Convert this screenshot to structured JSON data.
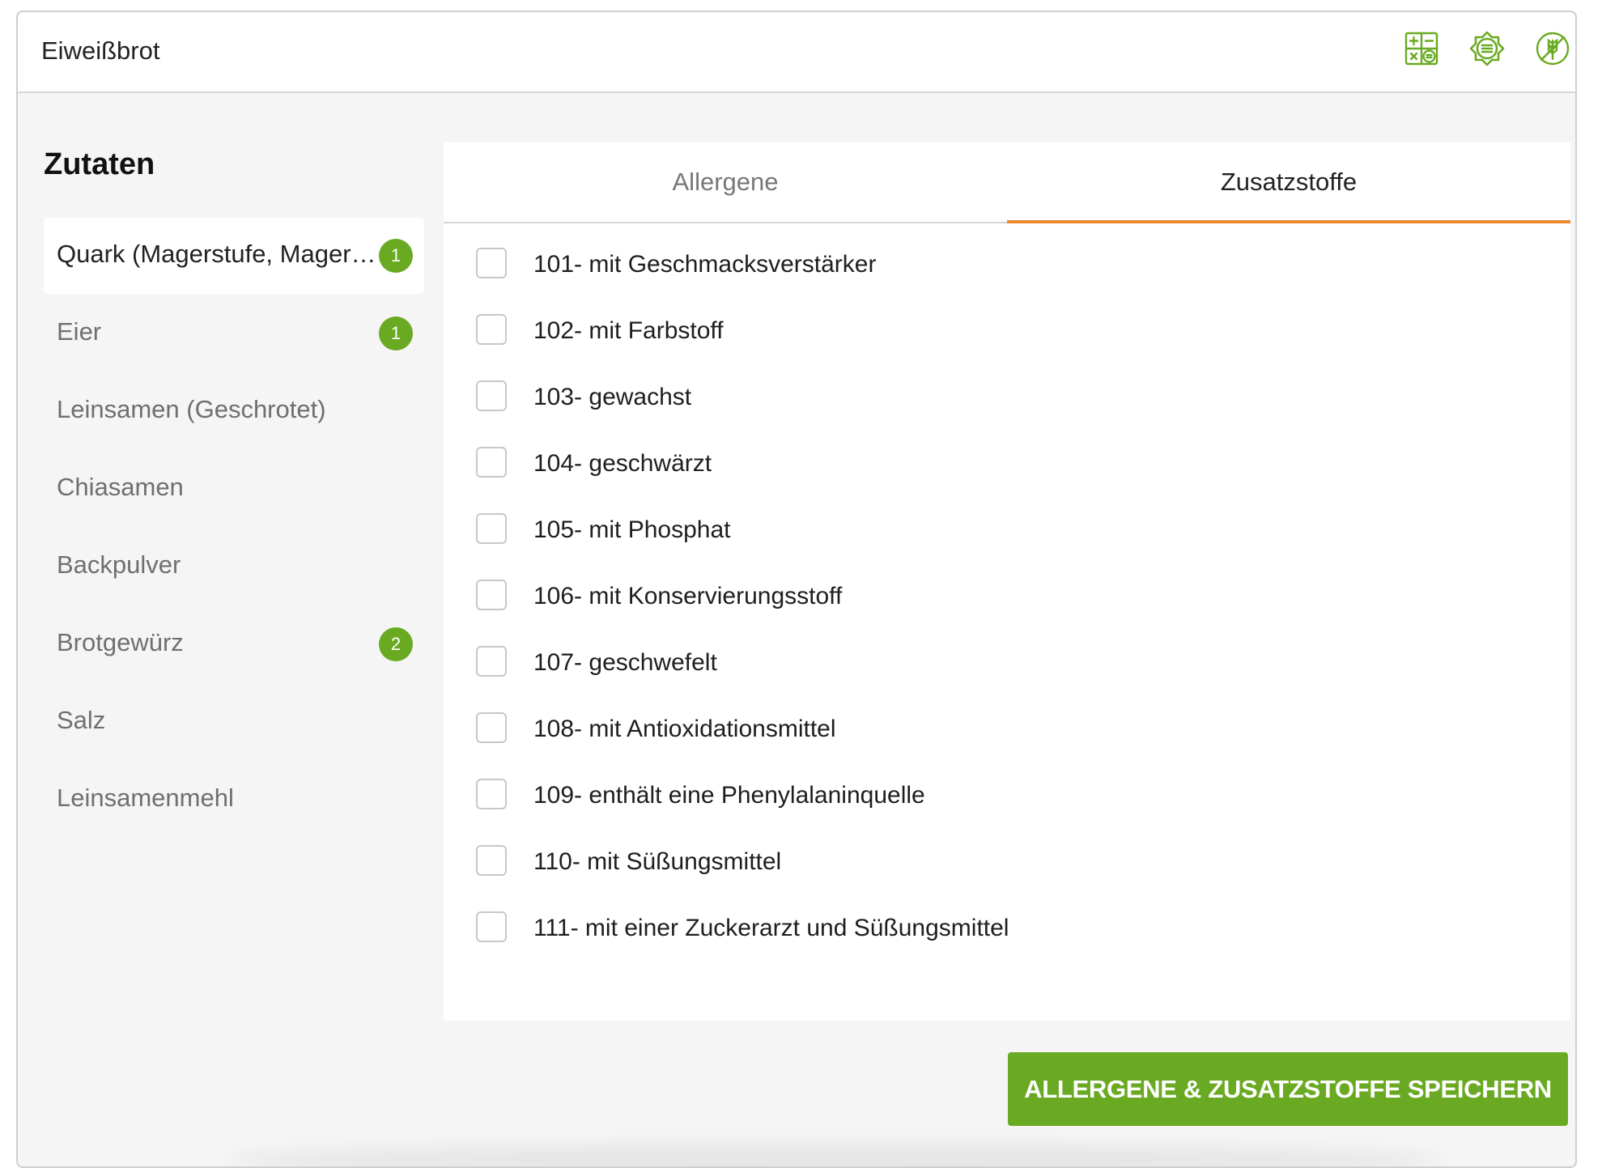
{
  "header": {
    "title": "Eiweißbrot",
    "icons": [
      "calculator-icon",
      "nutrition-settings-icon",
      "gluten-free-icon"
    ],
    "accent_color": "#6aaa22"
  },
  "sidebar": {
    "title": "Zutaten",
    "items": [
      {
        "label": "Quark (Magerstufe, Magerquark)",
        "badge": "1",
        "active": true
      },
      {
        "label": "Eier",
        "badge": "1",
        "active": false
      },
      {
        "label": "Leinsamen (Geschrotet)",
        "badge": null,
        "active": false
      },
      {
        "label": "Chiasamen",
        "badge": null,
        "active": false
      },
      {
        "label": "Backpulver",
        "badge": null,
        "active": false
      },
      {
        "label": "Brotgewürz",
        "badge": "2",
        "active": false
      },
      {
        "label": "Salz",
        "badge": null,
        "active": false
      },
      {
        "label": "Leinsamenmehl",
        "badge": null,
        "active": false
      }
    ]
  },
  "tabs": [
    {
      "label": "Allergene",
      "active": false
    },
    {
      "label": "Zusatzstoffe",
      "active": true
    }
  ],
  "tab_indicator_color": "#e9892b",
  "additives": [
    {
      "label": "101- mit Geschmacksverstärker",
      "checked": false
    },
    {
      "label": "102- mit Farbstoff",
      "checked": false
    },
    {
      "label": "103- gewachst",
      "checked": false
    },
    {
      "label": "104- geschwärzt",
      "checked": false
    },
    {
      "label": "105- mit Phosphat",
      "checked": false
    },
    {
      "label": "106- mit Konservierungsstoff",
      "checked": false
    },
    {
      "label": "107- geschwefelt",
      "checked": false
    },
    {
      "label": "108- mit Antioxidationsmittel",
      "checked": false
    },
    {
      "label": "109- enthält eine Phenylalaninquelle",
      "checked": false
    },
    {
      "label": "110- mit Süßungsmittel",
      "checked": false
    },
    {
      "label": "111- mit einer Zuckerarzt und Süßungsmittel",
      "checked": false
    }
  ],
  "footer": {
    "save_label": "ALLERGENE & ZUSATZSTOFFE SPEICHERN"
  }
}
